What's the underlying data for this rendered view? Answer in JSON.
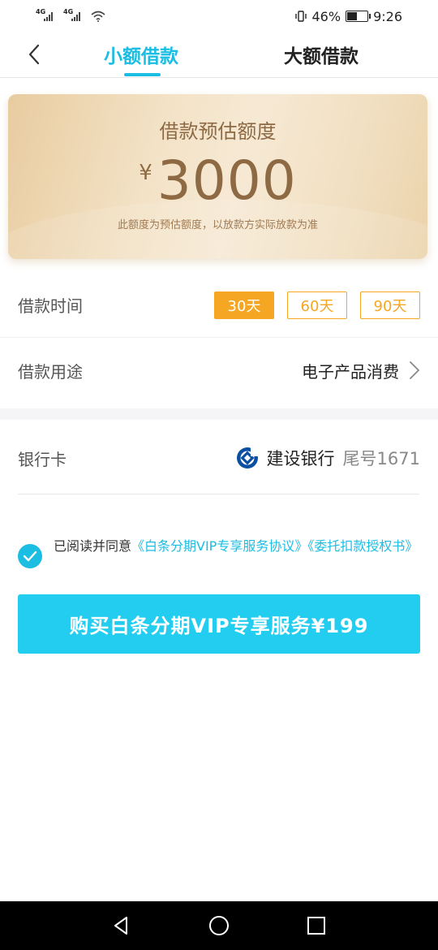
{
  "status_bar": {
    "network_1": "4G",
    "network_2": "4G",
    "battery_percent": "46%",
    "time": "9:26"
  },
  "header": {
    "tabs": [
      {
        "label": "小额借款",
        "active": true
      },
      {
        "label": "大额借款",
        "active": false
      }
    ]
  },
  "quota_card": {
    "title": "借款预估额度",
    "currency": "¥",
    "amount": "3000",
    "note": "此额度为预估额度，以放款方实际放款为准"
  },
  "loan_term": {
    "label": "借款时间",
    "options": [
      {
        "label": "30天",
        "selected": true
      },
      {
        "label": "60天",
        "selected": false
      },
      {
        "label": "90天",
        "selected": false
      }
    ]
  },
  "loan_purpose": {
    "label": "借款用途",
    "value": "电子产品消费"
  },
  "bank_card": {
    "label": "银行卡",
    "bank_name": "建设银行",
    "tail": "尾号1671"
  },
  "agreement": {
    "checked": true,
    "prefix": "已阅读并同意",
    "link_1": "《白条分期VIP专享服务协议》",
    "link_2": "《委托扣款授权书》"
  },
  "purchase_button": {
    "label": "购买白条分期VIP专享服务¥199"
  },
  "colors": {
    "accent": "#1cbde3",
    "button": "#22cdf0",
    "term_orange": "#f5a623",
    "card_text": "#8e6a44"
  }
}
